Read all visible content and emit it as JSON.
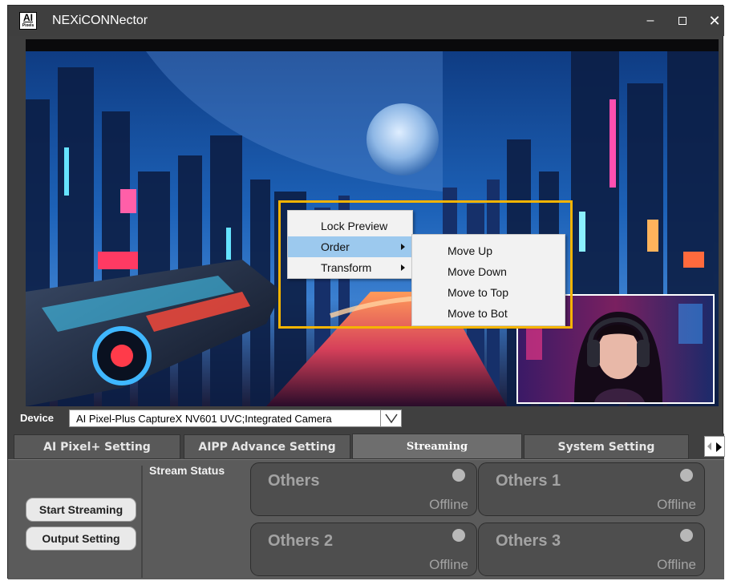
{
  "app": {
    "title": "NEXiCONNector",
    "logo_line1": "AI",
    "logo_line2": "Pixels",
    "icons": {
      "minimize": "minimize-icon",
      "maximize": "maximize-icon",
      "close": "close-icon"
    },
    "minimize_glyph": "–",
    "close_glyph": "✕"
  },
  "context_menu": {
    "items": [
      {
        "label": "Lock Preview",
        "has_submenu": false,
        "highlighted": false
      },
      {
        "label": "Order",
        "has_submenu": true,
        "highlighted": true
      },
      {
        "label": "Transform",
        "has_submenu": true,
        "highlighted": false
      }
    ],
    "submenu": {
      "items": [
        {
          "label": "Move Up"
        },
        {
          "label": "Move Down"
        },
        {
          "label": "Move to Top"
        },
        {
          "label": "Move to Bot"
        }
      ]
    },
    "highlight_color": "#f5b400",
    "selected_color": "#9cc9ee"
  },
  "device": {
    "label": "Device",
    "value": "AI Pixel-Plus CaptureX NV601 UVC;Integrated Camera",
    "dropdown_glyph": "∨"
  },
  "tabs": [
    {
      "label": "AI Pixel+ Setting",
      "active": false
    },
    {
      "label": "AIPP Advance Setting",
      "active": false
    },
    {
      "label": "Streaming",
      "active": true
    },
    {
      "label": "System Setting",
      "active": false
    }
  ],
  "streaming": {
    "start_button": "Start Streaming",
    "output_button": "Output Setting",
    "status_label": "Stream Status",
    "targets": [
      {
        "name": "Others",
        "status": "Offline"
      },
      {
        "name": "Others 1",
        "status": "Offline"
      },
      {
        "name": "Others 2",
        "status": "Offline"
      },
      {
        "name": "Others 3",
        "status": "Offline"
      }
    ]
  }
}
